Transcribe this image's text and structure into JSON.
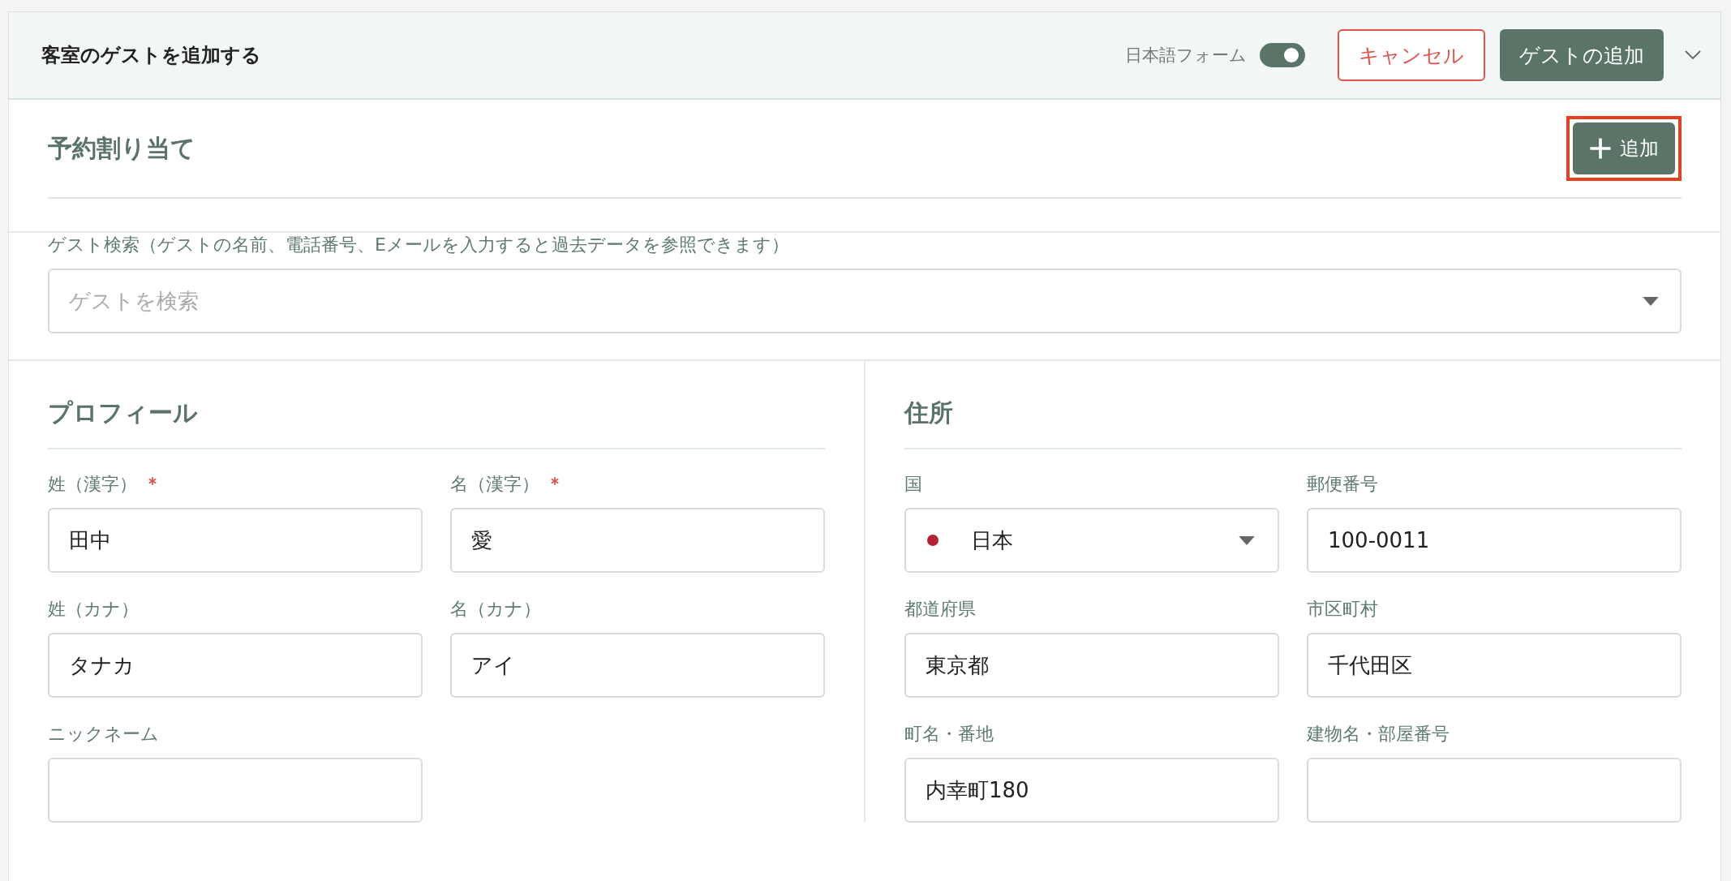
{
  "header": {
    "title": "客室のゲストを追加する",
    "toggle": {
      "label": "日本語フォーム",
      "on": true
    },
    "cancel_button": "キャンセル",
    "submit_button": "ゲストの追加"
  },
  "reservation": {
    "heading": "予約割り当て",
    "add_button": "追加"
  },
  "guest_search": {
    "label": "ゲスト検索（ゲストの名前、電話番号、Eメールを入力すると過去データを参照できます）",
    "placeholder": "ゲストを検索"
  },
  "profile": {
    "heading": "プロフィール",
    "fields": [
      {
        "label": "姓（漢字）",
        "required": true,
        "value": "田中"
      },
      {
        "label": "名（漢字）",
        "required": true,
        "value": "愛"
      },
      {
        "label": "姓（カナ）",
        "required": false,
        "value": "タナカ"
      },
      {
        "label": "名（カナ）",
        "required": false,
        "value": "アイ"
      },
      {
        "label": "ニックネーム",
        "required": false
      }
    ]
  },
  "address": {
    "heading": "住所",
    "fields": [
      {
        "label": "国",
        "kind": "select",
        "value": "日本"
      },
      {
        "label": "郵便番号",
        "kind": "text",
        "value": "100-0011"
      },
      {
        "label": "都道府県",
        "kind": "text",
        "value": "東京都"
      },
      {
        "label": "市区町村",
        "kind": "text",
        "value": "千代田区"
      },
      {
        "label": "町名・番地",
        "kind": "text",
        "value": "内幸町180"
      },
      {
        "label": "建物名・部屋番号",
        "kind": "text"
      }
    ]
  }
}
